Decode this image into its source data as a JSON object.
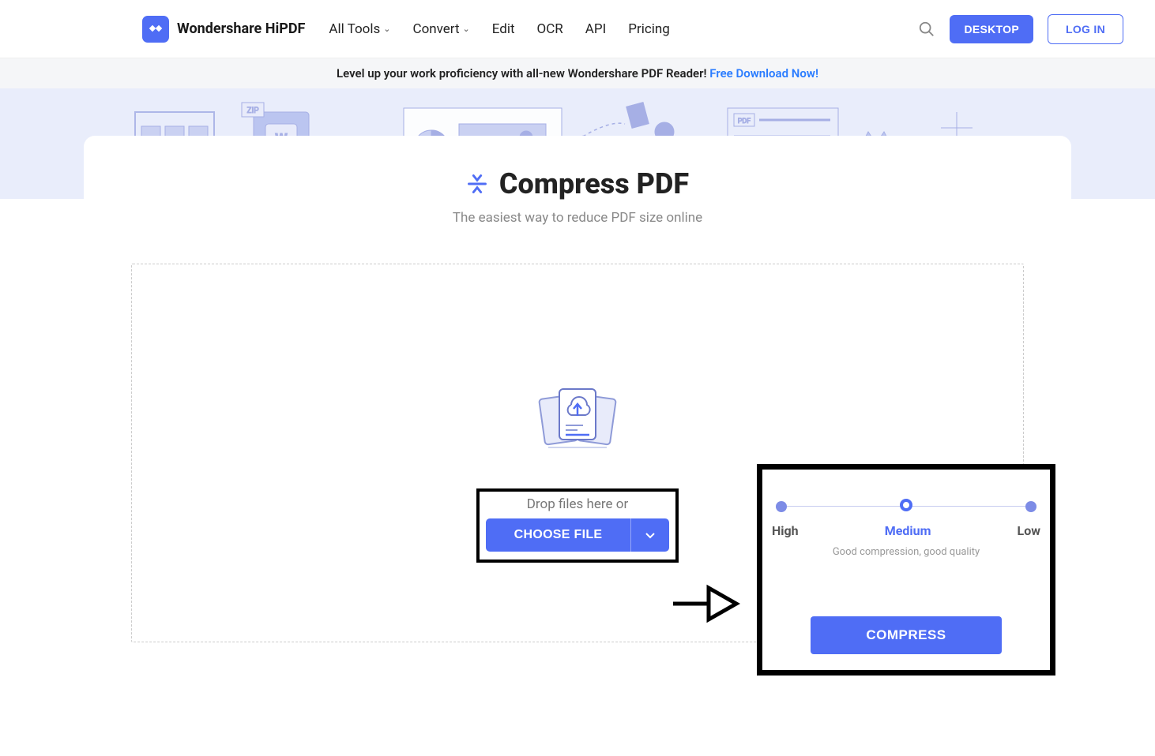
{
  "brand": "Wondershare HiPDF",
  "nav": {
    "all_tools": "All Tools",
    "convert": "Convert",
    "edit": "Edit",
    "ocr": "OCR",
    "api": "API",
    "pricing": "Pricing"
  },
  "header_buttons": {
    "desktop": "DESKTOP",
    "login": "LOG IN"
  },
  "banner": {
    "text": "Level up your work proficiency with all-new Wondershare PDF Reader! ",
    "link": "Free Download Now!"
  },
  "page": {
    "title": "Compress PDF",
    "subtitle": "The easiest way to reduce PDF size online"
  },
  "dropzone": {
    "hint": "Drop files here or",
    "choose": "CHOOSE FILE"
  },
  "compression": {
    "labels": {
      "high": "High",
      "medium": "Medium",
      "low": "Low"
    },
    "description": "Good compression, good quality",
    "button": "COMPRESS"
  }
}
